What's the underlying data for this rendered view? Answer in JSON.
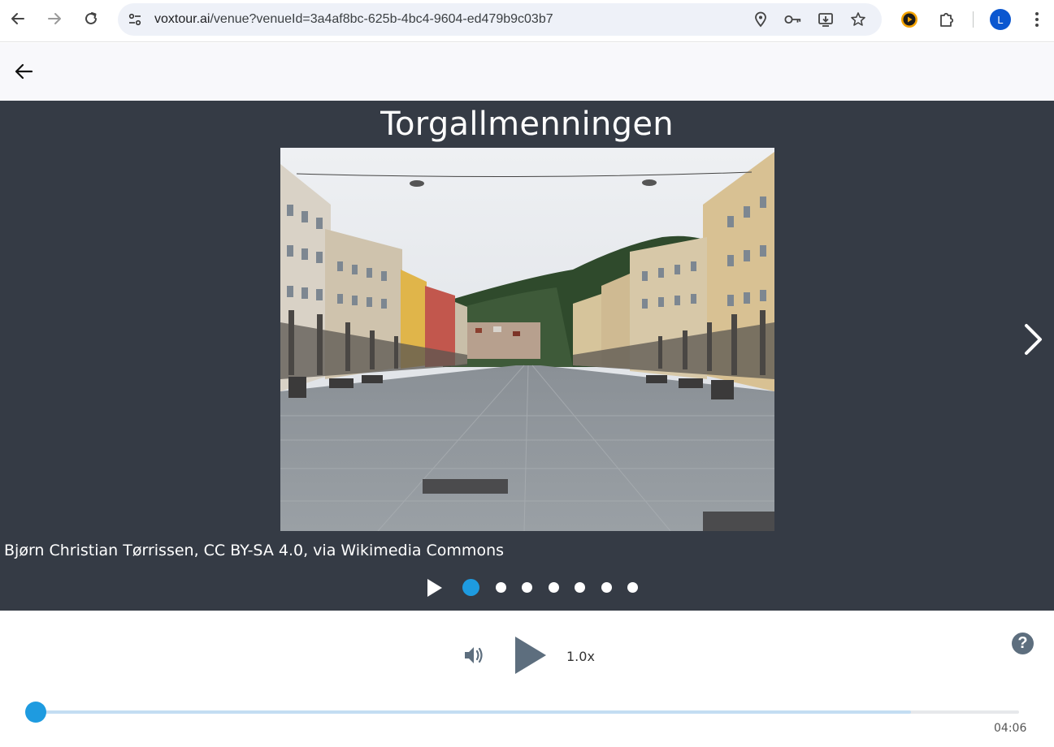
{
  "browser": {
    "url_host": "voxtour.ai",
    "url_path": "/venue?venueId=3a4af8bc-625b-4bc4-9604-ed479b9c03b7",
    "profile_initial": "L"
  },
  "venue": {
    "title": "Torgallmenningen",
    "image_credit": "Bjørn Christian Tørrissen, CC BY-SA 4.0, via Wikimedia Commons",
    "slides_count": 7,
    "active_slide": 1
  },
  "player": {
    "speed": "1.0x",
    "duration": "04:06",
    "progress": 0.0,
    "buffered": 0.89,
    "help_label": "?"
  },
  "colors": {
    "accent": "#1e9be0",
    "stage_bg": "#353b45",
    "play_icon": "#5d6e7e"
  }
}
